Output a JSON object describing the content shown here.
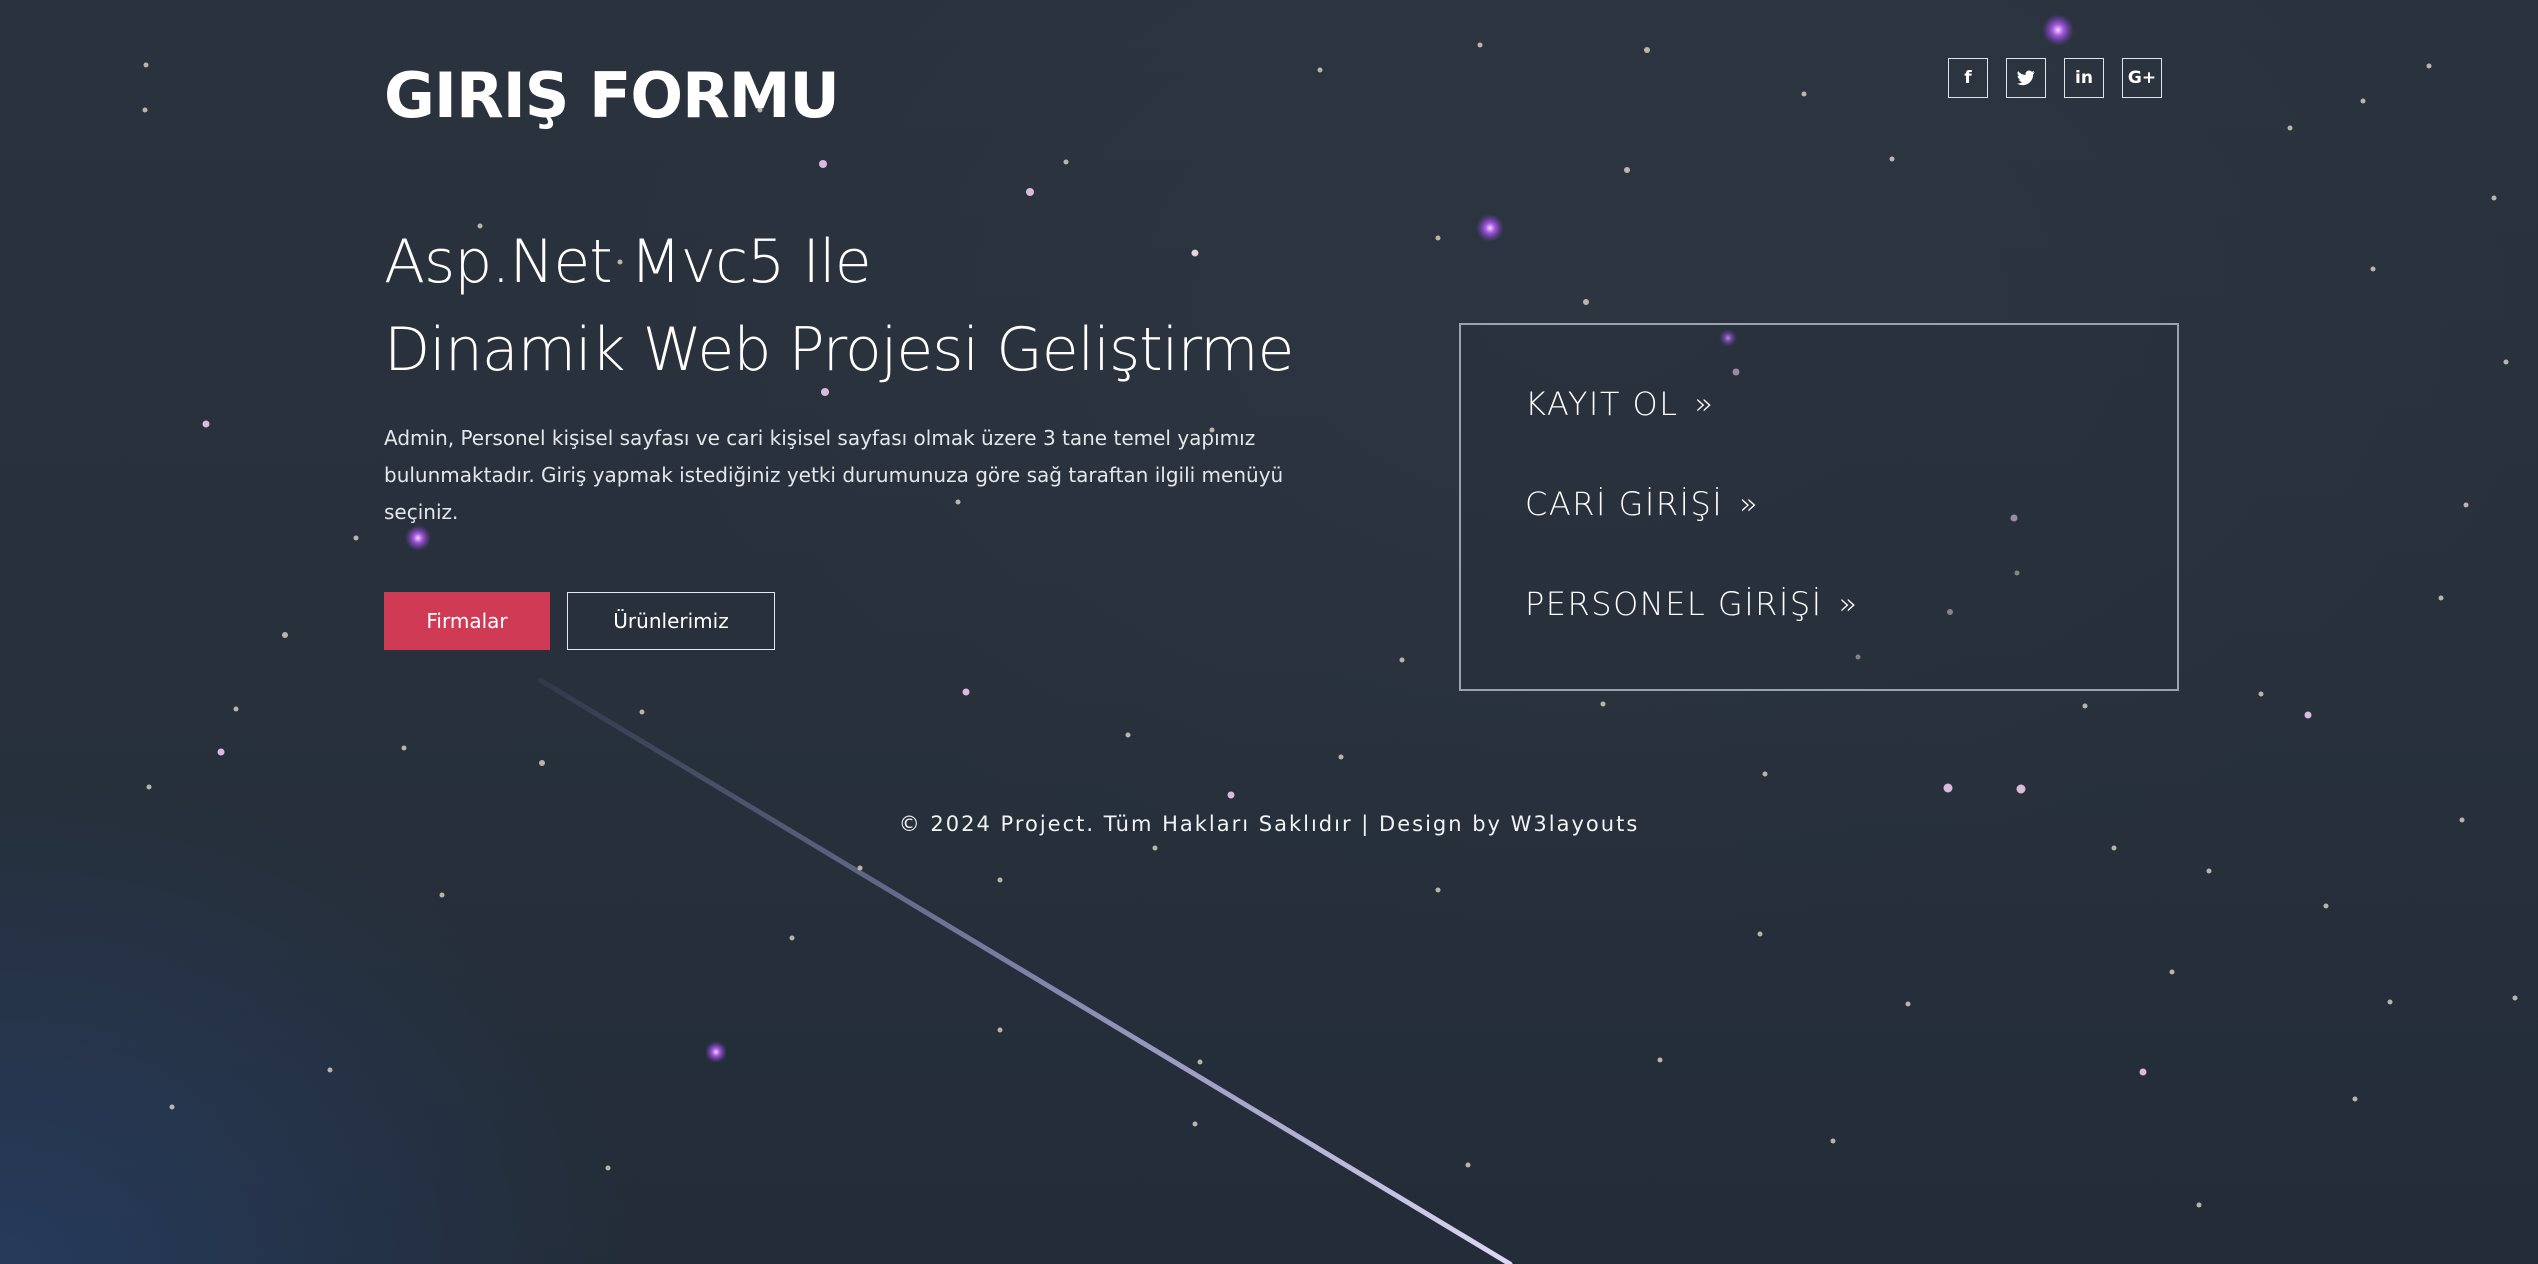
{
  "header": {
    "title": "GIRIŞ FORMU"
  },
  "social": {
    "items": [
      {
        "glyph": "f",
        "icon": "facebook-icon"
      },
      {
        "glyph": "t",
        "icon": "twitter-icon"
      },
      {
        "glyph": "in",
        "icon": "linkedin-icon"
      },
      {
        "glyph": "G+",
        "icon": "google-plus-icon"
      }
    ]
  },
  "hero": {
    "heading_line1": "Asp.Net Mvc5 Ile",
    "heading_line2": "Dinamik Web Projesi Geliştirme",
    "description": "Admin, Personel kişisel sayfası ve cari kişisel sayfası olmak üzere 3 tane temel yapımız bulunmaktadır. Giriş yapmak istediğiniz yetki durumunuza göre sağ taraftan ilgili menüyü seçiniz.",
    "primary_button": "Firmalar",
    "secondary_button": "Ürünlerimiz"
  },
  "login_panel": {
    "links": [
      {
        "label": "KAYIT OL",
        "arrow": "»"
      },
      {
        "label": "CARİ GİRİŞİ",
        "arrow": "»"
      },
      {
        "label": "PERSONEL GİRİŞİ",
        "arrow": "»"
      }
    ]
  },
  "footer": {
    "copyright": "© 2024 Project. Tüm Hakları Saklıdır | Design by",
    "credit": "W3layouts"
  },
  "colors": {
    "background": "#26303b",
    "accent": "#cf3a55",
    "panel_border": "#9aa2ac"
  }
}
